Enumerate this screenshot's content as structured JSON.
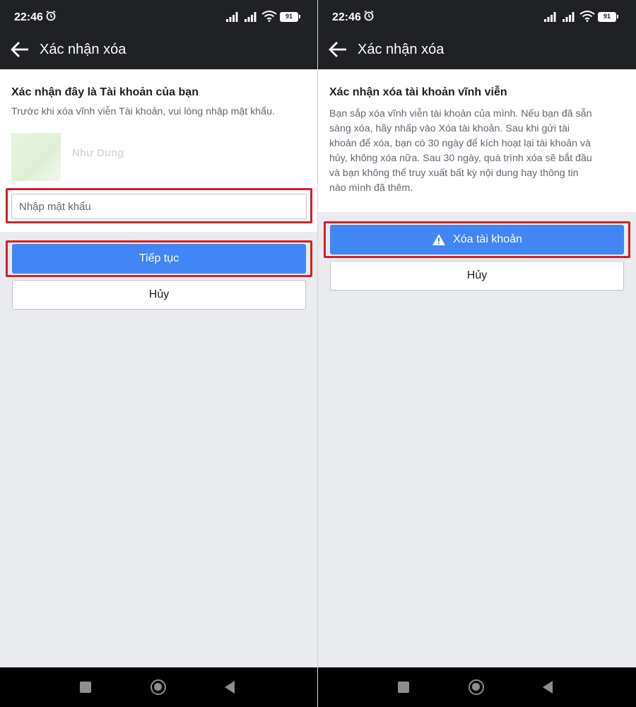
{
  "status": {
    "time": "22:46",
    "battery": "91"
  },
  "left": {
    "toolbar_title": "Xác nhận xóa",
    "heading": "Xác nhận đây là Tài khoản của bạn",
    "subtext": "Trước khi xóa vĩnh viễn Tài khoản, vui lòng nhập mật khẩu.",
    "profile_name": "Như Dung",
    "password_placeholder": "Nhập mật khẩu",
    "continue_label": "Tiếp tục",
    "cancel_label": "Hủy"
  },
  "right": {
    "toolbar_title": "Xác nhận xóa",
    "heading": "Xác nhận xóa tài khoản vĩnh viễn",
    "body_lines": [
      "Bạn sắp xóa vĩnh viễn tài khoản của mình. Nếu bạn đã sẵn",
      "sàng xóa, hãy nhấp vào Xóa tài khoản. Sau khi gửi tài",
      "khoản để xóa, bạn có 30 ngày để kích hoạt lại tài khoản và",
      "hủy, không xóa nữa. Sau 30 ngày, quá trình xóa sẽ bắt đầu",
      "và bạn không thể truy xuất bất kỳ nội dung hay thông tin",
      "nào mình đã thêm."
    ],
    "delete_label": "Xóa tài khoản",
    "cancel_label": "Hủy"
  },
  "icons": [
    "alarm-icon",
    "signal-icon",
    "wifi-icon",
    "battery-icon",
    "back-arrow-icon",
    "warning-icon",
    "recents-icon",
    "home-icon",
    "nav-back-icon"
  ],
  "colors": {
    "toolbar": "#202124",
    "primary_button": "#4285f4",
    "highlight": "#d32026",
    "background": "#e9ebee"
  }
}
